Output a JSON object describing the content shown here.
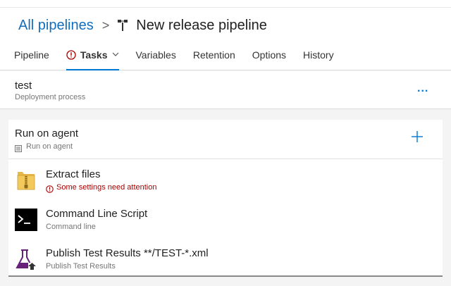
{
  "breadcrumb": {
    "root_link": "All pipelines",
    "separator": ">",
    "title": "New release pipeline"
  },
  "tabs": [
    {
      "label": "Pipeline"
    },
    {
      "label": "Tasks",
      "active": true,
      "warning": true
    },
    {
      "label": "Variables"
    },
    {
      "label": "Retention"
    },
    {
      "label": "Options"
    },
    {
      "label": "History"
    }
  ],
  "stage": {
    "name": "test",
    "subtitle": "Deployment process",
    "more_label": "..."
  },
  "agent_job": {
    "title": "Run on agent",
    "subtitle": "Run on agent",
    "add_label": "+"
  },
  "tasks": [
    {
      "name": "Extract files",
      "subtitle": "Some settings need attention",
      "status": "error",
      "icon": "zip-folder-icon"
    },
    {
      "name": "Command Line Script",
      "subtitle": "Command line",
      "icon": "terminal-icon"
    },
    {
      "name": "Publish Test Results **/TEST-*.xml",
      "subtitle": "Publish Test Results",
      "icon": "test-flask-icon"
    }
  ],
  "colors": {
    "accent": "#0078d4",
    "link": "#106ebe",
    "error": "#a80000",
    "background": "#f4f4f4"
  }
}
